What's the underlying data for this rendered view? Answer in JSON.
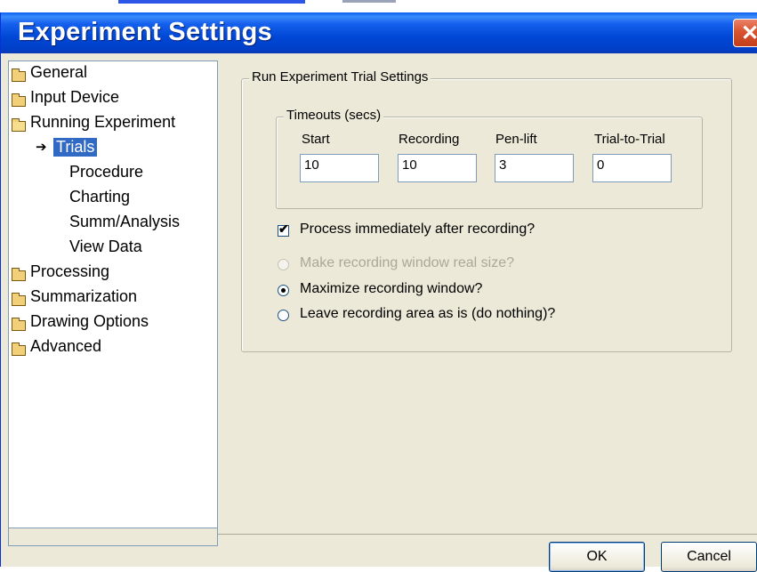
{
  "dialog": {
    "title": "Experiment Settings",
    "close_icon": "close-icon",
    "ok_label": "OK",
    "cancel_label": "Cancel"
  },
  "nav": {
    "items": [
      {
        "label": "General",
        "icon": "folder-icon"
      },
      {
        "label": "Input Device",
        "icon": "folder-icon"
      },
      {
        "label": "Running Experiment",
        "icon": "open-folder-icon"
      },
      {
        "label": "Trials",
        "icon": "arrow-right-icon",
        "selected": true
      },
      {
        "label": "Procedure"
      },
      {
        "label": "Charting"
      },
      {
        "label": "Summ/Analysis"
      },
      {
        "label": "View Data"
      },
      {
        "label": "Processing",
        "icon": "folder-icon"
      },
      {
        "label": "Summarization",
        "icon": "folder-icon"
      },
      {
        "label": "Drawing Options",
        "icon": "folder-icon"
      },
      {
        "label": "Advanced",
        "icon": "folder-icon"
      }
    ]
  },
  "trial_settings": {
    "group_label": "Run Experiment Trial Settings",
    "timeouts": {
      "group_label": "Timeouts (secs)",
      "fields": [
        {
          "label": "Start",
          "value": "10"
        },
        {
          "label": "Recording",
          "value": "10"
        },
        {
          "label": "Pen-lift",
          "value": "3"
        },
        {
          "label": "Trial-to-Trial",
          "value": "0"
        }
      ]
    },
    "process_checkbox": {
      "label": "Process immediately after recording?",
      "checked": true
    },
    "window_options": [
      {
        "label": "Make recording window real size?",
        "selected": false,
        "enabled": false
      },
      {
        "label": "Maximize recording window?",
        "selected": true,
        "enabled": true
      },
      {
        "label": "Leave recording area as is (do nothing)?",
        "selected": false,
        "enabled": true
      }
    ]
  },
  "colors": {
    "titlebar": "#0047d5",
    "selection": "#316ac5",
    "dialog_face": "#ece9d8"
  }
}
